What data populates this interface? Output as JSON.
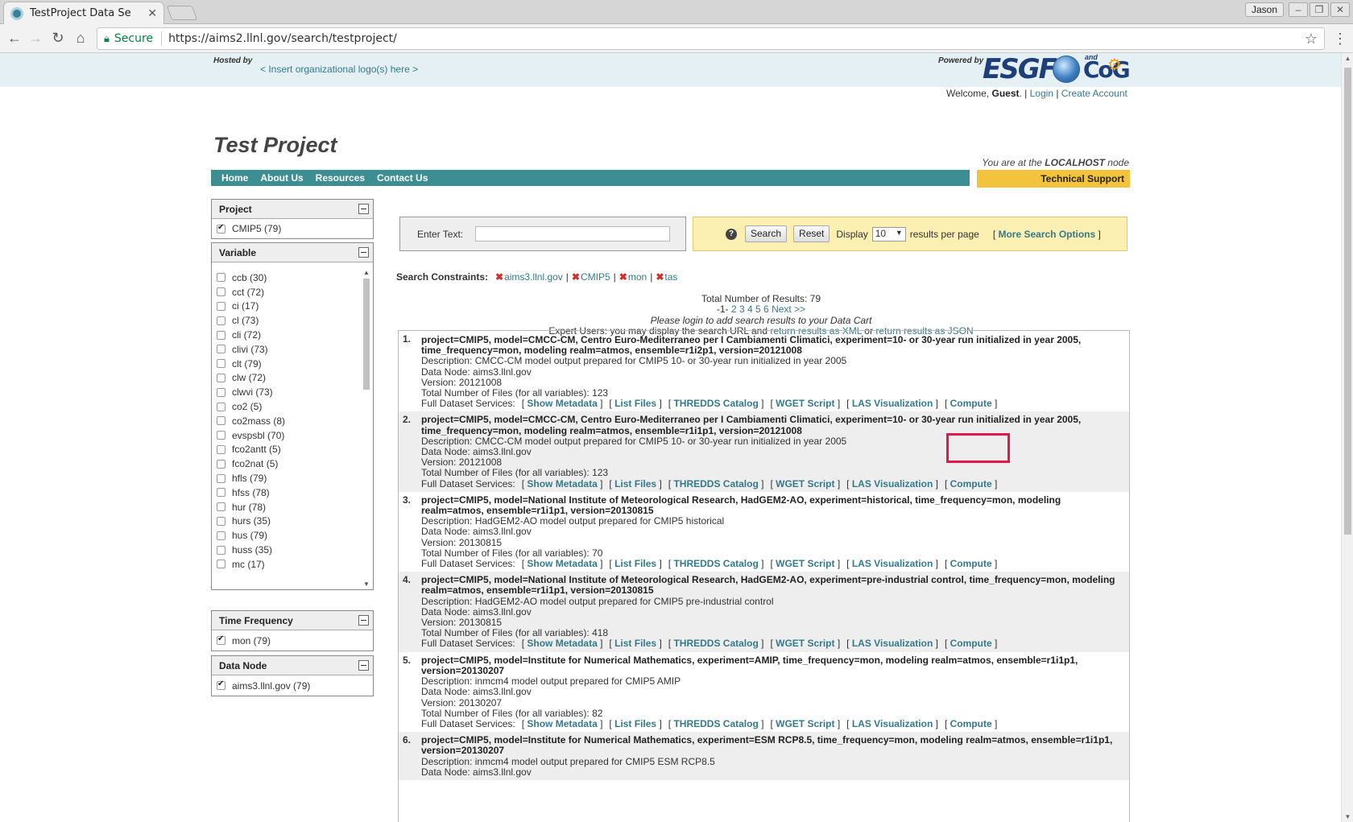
{
  "browser": {
    "tab_title": "TestProject Data Se",
    "user_badge": "Jason",
    "secure_label": "Secure",
    "url": "https://aims2.llnl.gov/search/testproject/"
  },
  "header": {
    "hosted_by": "Hosted by",
    "org_logo_link": "< Insert organizational logo(s) here >",
    "powered_by": "Powered by",
    "logo_esgf": "ESGF",
    "logo_and": "and",
    "logo_cog": "CoG",
    "welcome_prefix": "Welcome,",
    "welcome_user": "Guest",
    "login": "Login",
    "create_account": "Create Account"
  },
  "site": {
    "project_title": "Test Project",
    "nav": [
      "Home",
      "About Us",
      "Resources",
      "Contact Us"
    ],
    "node_prefix": "You are at the",
    "node_name": "LOCALHOST",
    "node_suffix": "node",
    "tech_support": "Technical Support"
  },
  "facets": {
    "project": {
      "title": "Project",
      "items": [
        {
          "label": "CMIP5 (79)",
          "checked": true
        }
      ]
    },
    "variable": {
      "title": "Variable",
      "items": [
        "ccb (30)",
        "cct (72)",
        "ci (17)",
        "cl (73)",
        "cli (72)",
        "clivi (73)",
        "clt (79)",
        "clw (72)",
        "clwvi (73)",
        "co2 (5)",
        "co2mass (8)",
        "evspsbl (70)",
        "fco2antt (5)",
        "fco2nat (5)",
        "hfls (79)",
        "hfss (78)",
        "hur (78)",
        "hurs (35)",
        "hus (79)",
        "huss (35)",
        "mc (17)"
      ]
    },
    "time_frequency": {
      "title": "Time Frequency",
      "items": [
        {
          "label": "mon (79)",
          "checked": true
        }
      ]
    },
    "data_node": {
      "title": "Data Node",
      "items": [
        {
          "label": "aims3.llnl.gov (79)",
          "checked": true
        }
      ]
    }
  },
  "search": {
    "enter_text_label": "Enter Text:",
    "input_value": "",
    "search_button": "Search",
    "reset_button": "Reset",
    "display_label": "Display",
    "results_per_page": "10",
    "results_per_page_suffix": "results per page",
    "more_options": "More Search Options"
  },
  "constraints": {
    "label": "Search Constraints:",
    "items": [
      "aims3.llnl.gov",
      "CMIP5",
      "mon",
      "tas"
    ]
  },
  "summary": {
    "total": "Total Number of Results: 79",
    "current_page": "-1-",
    "pages": [
      "2",
      "3",
      "4",
      "5",
      "6"
    ],
    "next": "Next >>",
    "login_note": "Please login to add search results to your Data Cart",
    "expert_text": "Expert Users: you may display the search URL and",
    "xml_link": "return results as XML",
    "or": "or",
    "json_link": "return results as JSON"
  },
  "result_labels": {
    "full_services": "Full Dataset Services:",
    "services": [
      "Show Metadata",
      "List Files",
      "THREDDS Catalog",
      "WGET Script",
      "LAS Visualization",
      "Compute"
    ]
  },
  "results": [
    {
      "num": "1.",
      "title": "project=CMIP5, model=CMCC-CM, Centro Euro-Mediterraneo per I Cambiamenti Climatici, experiment=10- or 30-year run initialized in year 2005, time_frequency=mon, modeling realm=atmos, ensemble=r1i2p1, version=20121008",
      "description": "Description: CMCC-CM model output prepared for CMIP5 10- or 30-year run initialized in year 2005",
      "data_node": "Data Node: aims3.llnl.gov",
      "version": "Version: 20121008",
      "files": "Total Number of Files (for all variables): 123"
    },
    {
      "num": "2.",
      "title": "project=CMIP5, model=CMCC-CM, Centro Euro-Mediterraneo per I Cambiamenti Climatici, experiment=10- or 30-year run initialized in year 2005, time_frequency=mon, modeling realm=atmos, ensemble=r1i1p1, version=20121008",
      "description": "Description: CMCC-CM model output prepared for CMIP5 10- or 30-year run initialized in year 2005",
      "data_node": "Data Node: aims3.llnl.gov",
      "version": "Version: 20121008",
      "files": "Total Number of Files (for all variables): 123"
    },
    {
      "num": "3.",
      "title": "project=CMIP5, model=National Institute of Meteorological Research, HadGEM2-AO, experiment=historical, time_frequency=mon, modeling realm=atmos, ensemble=r1i1p1, version=20130815",
      "description": "Description: HadGEM2-AO model output prepared for CMIP5 historical",
      "data_node": "Data Node: aims3.llnl.gov",
      "version": "Version: 20130815",
      "files": "Total Number of Files (for all variables): 70"
    },
    {
      "num": "4.",
      "title": "project=CMIP5, model=National Institute of Meteorological Research, HadGEM2-AO, experiment=pre-industrial control, time_frequency=mon, modeling realm=atmos, ensemble=r1i1p1, version=20130815",
      "description": "Description: HadGEM2-AO model output prepared for CMIP5 pre-industrial control",
      "data_node": "Data Node: aims3.llnl.gov",
      "version": "Version: 20130815",
      "files": "Total Number of Files (for all variables): 418"
    },
    {
      "num": "5.",
      "title": "project=CMIP5, model=Institute for Numerical Mathematics, experiment=AMIP, time_frequency=mon, modeling realm=atmos, ensemble=r1i1p1, version=20130207",
      "description": "Description: inmcm4 model output prepared for CMIP5 AMIP",
      "data_node": "Data Node: aims3.llnl.gov",
      "version": "Version: 20130207",
      "files": "Total Number of Files (for all variables): 82"
    },
    {
      "num": "6.",
      "title": "project=CMIP5, model=Institute for Numerical Mathematics, experiment=ESM RCP8.5, time_frequency=mon, modeling realm=atmos, ensemble=r1i1p1, version=20130207",
      "description": "Description: inmcm4 model output prepared for CMIP5 ESM RCP8.5",
      "data_node": "Data Node: aims3.llnl.gov",
      "version": "",
      "files": ""
    }
  ]
}
